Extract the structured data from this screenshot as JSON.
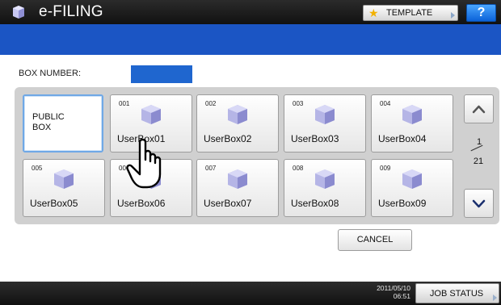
{
  "header": {
    "app_title": "e-FILING",
    "app_icon": "e-filing-icon",
    "template_button": "TEMPLATE",
    "help_button": "?"
  },
  "box_number": {
    "label": "BOX NUMBER:",
    "value": ""
  },
  "public_box": {
    "label": "PUBLIC\nBOX"
  },
  "boxes": [
    {
      "number": "001",
      "name": "UserBox01"
    },
    {
      "number": "002",
      "name": "UserBox02"
    },
    {
      "number": "003",
      "name": "UserBox03"
    },
    {
      "number": "004",
      "name": "UserBox04"
    },
    {
      "number": "005",
      "name": "UserBox05"
    },
    {
      "number": "006",
      "name": "UserBox06"
    },
    {
      "number": "007",
      "name": "UserBox07"
    },
    {
      "number": "008",
      "name": "UserBox08"
    },
    {
      "number": "009",
      "name": "UserBox09"
    }
  ],
  "pagination": {
    "current": "1",
    "total": "21"
  },
  "cancel_button": "CANCEL",
  "status": {
    "date": "2011/05/10",
    "time": "06:51",
    "job_status_button": "JOB STATUS"
  },
  "colors": {
    "accent_blue": "#1b55c4",
    "help_blue": "#1a78f0",
    "tile_cube": "#9b9bd6"
  }
}
